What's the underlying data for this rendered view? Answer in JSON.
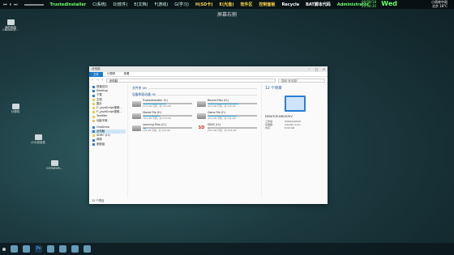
{
  "topbar": {
    "segments": [
      "TrustedInstaller",
      "C(系统)",
      "D(软件)",
      "E(文档)",
      "F(游戏)",
      "G(学习)",
      "H(SD卡)",
      "E(光盘)",
      "软件区",
      "控制面板",
      "Recycle",
      "BAT脚本代码",
      "Administrator"
    ],
    "clock": [
      "06/08/18",
      "21:08:30"
    ],
    "big_time": "Wed",
    "weather": [
      "小雨转中雨",
      "北京 18°C"
    ]
  },
  "desktop_title": "屏幕右侧",
  "desktop_icons": [
    "我的电脑",
    "CNNSKQF...",
    "计算机",
    "小小说目录",
    "CGYNEGR..."
  ],
  "window": {
    "title": "此电脑",
    "ribbon_tabs": [
      "文件",
      "计算机",
      "查看"
    ],
    "address": "此电脑",
    "search_placeholder": "搜索\"此电脑\"",
    "nav": {
      "quick_access": "快速访问",
      "items": [
        "Desktop",
        "下载",
        "文档",
        "图片",
        "F:_JavaScript视频...",
        "F:_JavaScript视频...",
        "Tooltiter",
        "功能不够"
      ],
      "onedrive": "OneDrive",
      "this_pc": "此电脑",
      "sdhc": "SDHC (H:)",
      "network": "网络",
      "homegroup": "家庭组"
    },
    "folders_header": "文件夹 (6)",
    "devices_header": "设备和驱动器 (6)",
    "drives": [
      {
        "name": "TrustedInstaller (C:)",
        "free": "57.6 GB 可用，共 110 GB",
        "fill": 0.48
      },
      {
        "name": "Recent Files (D:)",
        "free": "43.6 GB 可用，共 116 GB",
        "fill": 0.62
      },
      {
        "name": "Stored File (E:)",
        "free": "76.9 GB 可用，共 116 GB",
        "fill": 0.34
      },
      {
        "name": "Game File (F:)",
        "free": "40.6 GB 可用，共 101 GB",
        "fill": 0.6
      },
      {
        "name": "Learning Files (G:)",
        "free": "118 GB 可用，共 116 GB",
        "fill": 0.05
      },
      {
        "name": "SDHC (H:)",
        "free": "28.8 GB 可用，共 28.8 GB",
        "fill": 0.02
      }
    ],
    "details": {
      "count": "12 个项目",
      "host": "DESKTOP-BRCN7EV",
      "rows": [
        [
          "工作组:",
          "WORKGROUP"
        ],
        [
          "处理器:",
          "Intel(R) Core..."
        ],
        [
          "内存:",
          "8.00 GB"
        ]
      ]
    },
    "status": "12 个项目"
  },
  "taskbar": [
    "start",
    "files",
    "browser",
    "ps",
    "music",
    "chat",
    "mail",
    "store"
  ]
}
